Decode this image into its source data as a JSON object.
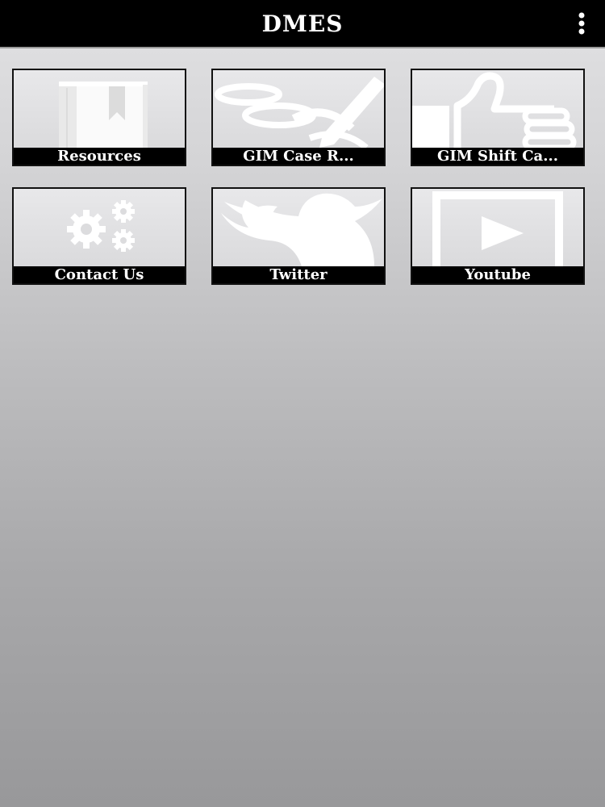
{
  "app": {
    "title": "DMES",
    "menu_icon": "kebab-menu-icon"
  },
  "tiles": [
    {
      "label": "Resources",
      "icon": "bookmark-book-icon"
    },
    {
      "label": "GIM Case R...",
      "icon": "pen-writing-icon"
    },
    {
      "label": "GIM Shift Ca...",
      "icon": "thumbs-up-icon"
    },
    {
      "label": "Contact Us",
      "icon": "gears-icon"
    },
    {
      "label": "Twitter",
      "icon": "twitter-bird-icon"
    },
    {
      "label": "Youtube",
      "icon": "play-button-icon"
    }
  ],
  "colors": {
    "header_bg": "#000000",
    "header_text": "#ffffff",
    "label_bg": "#000000",
    "label_text": "#ffffff",
    "icon_color": "#ffffff"
  }
}
